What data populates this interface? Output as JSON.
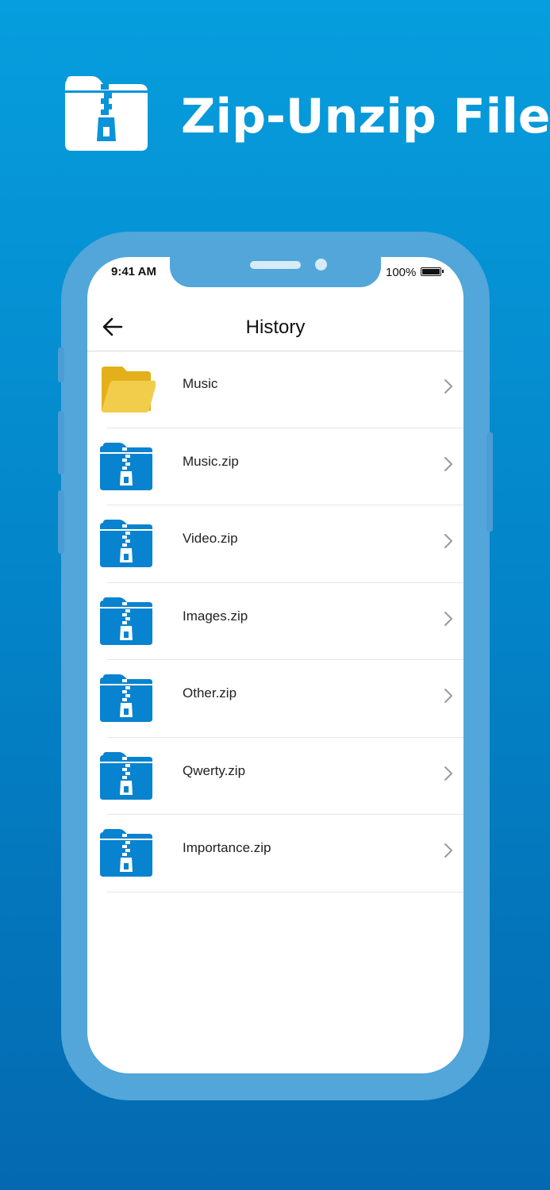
{
  "banner": {
    "title": "Zip-Unzip File",
    "logo_icon": "zip-folder-icon"
  },
  "status_bar": {
    "time": "9:41 AM",
    "battery": "100%"
  },
  "app_bar": {
    "title": "History",
    "back_icon": "arrow-left-icon"
  },
  "history": {
    "items": [
      {
        "label": "Music",
        "icon": "folder-icon"
      },
      {
        "label": "Music.zip",
        "icon": "zip-folder-icon"
      },
      {
        "label": "Video.zip",
        "icon": "zip-folder-icon"
      },
      {
        "label": "Images.zip",
        "icon": "zip-folder-icon"
      },
      {
        "label": "Other.zip",
        "icon": "zip-folder-icon"
      },
      {
        "label": "Qwerty.zip",
        "icon": "zip-folder-icon"
      },
      {
        "label": "Importance.zip",
        "icon": "zip-folder-icon"
      }
    ]
  },
  "colors": {
    "brand_blue": "#0883cf",
    "folder_yellow": "#f2cd4b",
    "frame": "#52a6d9"
  }
}
